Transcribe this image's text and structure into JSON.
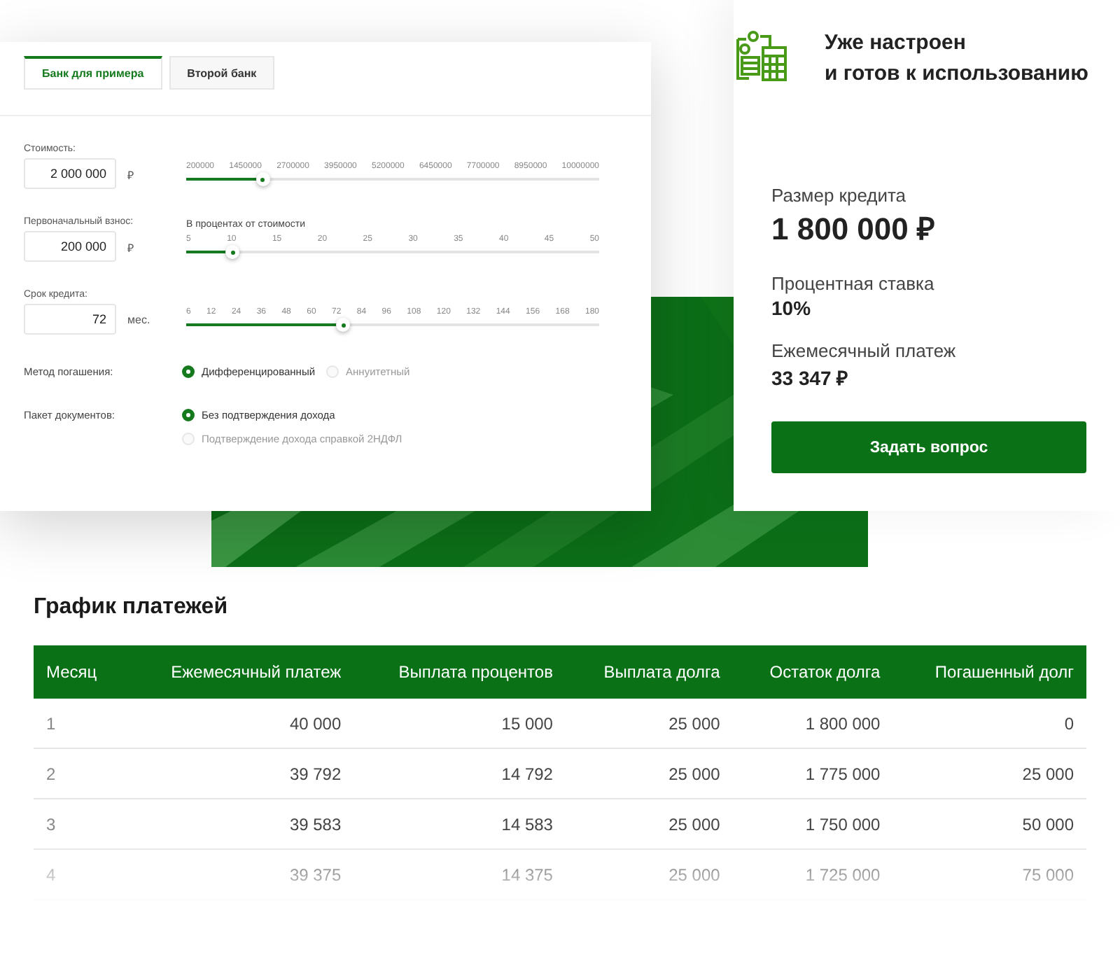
{
  "calculator": {
    "tabs": [
      {
        "label": "Банк для примера",
        "selected": true
      },
      {
        "label": "Второй банк",
        "selected": false
      }
    ],
    "fields": [
      {
        "label": "Стоимость:",
        "value": "2 000 000",
        "unit": "₽",
        "ticks": [
          "200000",
          "1450000",
          "2700000",
          "3950000",
          "5200000",
          "6450000",
          "7700000",
          "8950000",
          "10000000"
        ],
        "level": 0.186
      },
      {
        "label": "Первоначальный взнос:",
        "value": "200 000",
        "unit": "₽",
        "caption": "В процентах от стоимости",
        "ticks": [
          "5",
          "10",
          "15",
          "20",
          "25",
          "30",
          "35",
          "40",
          "45",
          "50"
        ],
        "level": 0.112
      },
      {
        "label": "Срок кредита:",
        "value": "72",
        "unit": "мес.",
        "ticks": [
          "6",
          "12",
          "24",
          "36",
          "48",
          "60",
          "72",
          "84",
          "96",
          "108",
          "120",
          "132",
          "144",
          "156",
          "168",
          "180"
        ],
        "level": 0.38
      }
    ],
    "options": [
      {
        "label": "Метод погашения:",
        "kind": "row",
        "choices": [
          {
            "label": "Дифференцированный",
            "selected": true
          },
          {
            "label": "Аннуитетный",
            "selected": false
          }
        ]
      },
      {
        "label": "Пакет документов:",
        "kind": "column",
        "choices": [
          {
            "label": "Без подтверждения дохода",
            "selected": true
          },
          {
            "label": "Подтверждение дохода справкой 2НДФЛ",
            "selected": false
          }
        ]
      }
    ]
  },
  "summary": {
    "headline": [
      "Уже настроен",
      "и готов к использованию"
    ],
    "results": [
      {
        "label": "Размер кредита",
        "value": "1 800 000 ₽",
        "kind": "large"
      },
      {
        "label": "Процентная ставка",
        "value": "10%",
        "kind": "small"
      },
      {
        "label": "Ежемесячный платеж",
        "value": "33 347 ₽",
        "kind": "small"
      }
    ],
    "button": "Задать вопрос"
  },
  "schedule": {
    "title": "График платежей",
    "columns": [
      "Месяц",
      "Ежемесячный платеж",
      "Выплата процентов",
      "Выплата долга",
      "Остаток долга",
      "Погашенный долг"
    ],
    "rows": [
      [
        "1",
        "40 000",
        "15 000",
        "25 000",
        "1 800 000",
        "0"
      ],
      [
        "2",
        "39 792",
        "14 792",
        "25 000",
        "1 775 000",
        "25 000"
      ],
      [
        "3",
        "39 583",
        "14 583",
        "25 000",
        "1 750 000",
        "50 000"
      ],
      [
        "4",
        "39 375",
        "14 375",
        "25 000",
        "1 725 000",
        "75 000"
      ]
    ]
  }
}
